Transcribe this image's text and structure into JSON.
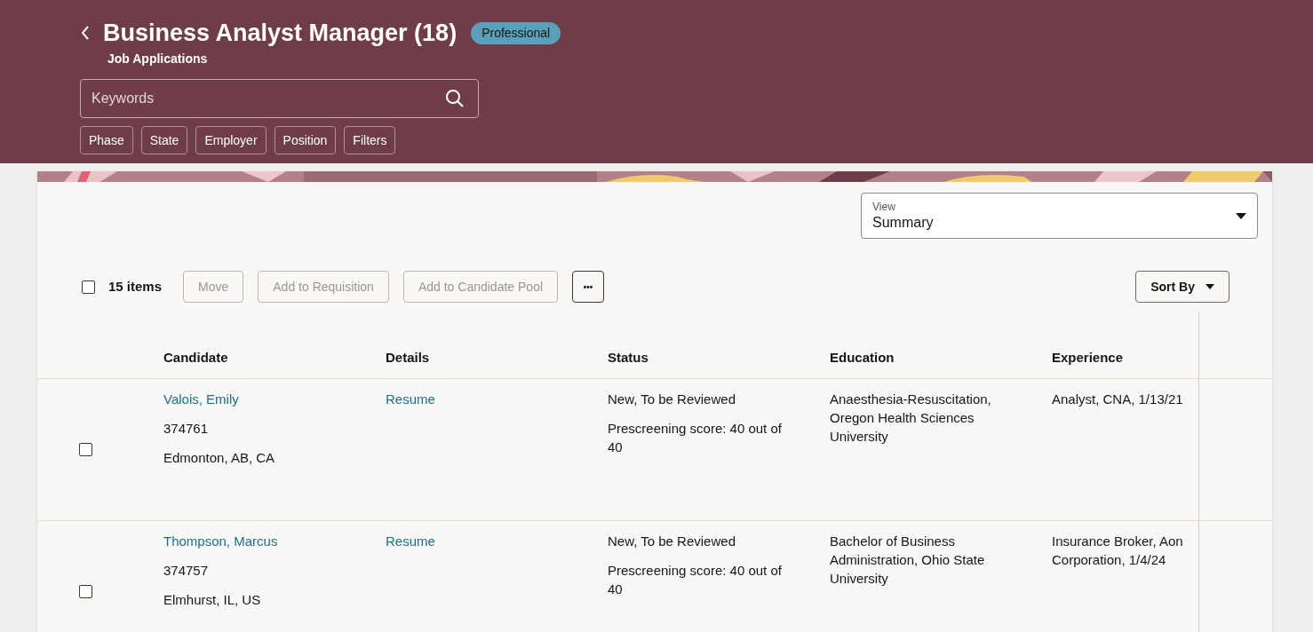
{
  "header": {
    "title": "Business Analyst Manager (18)",
    "badge": "Professional",
    "subtitle": "Job Applications"
  },
  "search": {
    "placeholder": "Keywords"
  },
  "filters": [
    "Phase",
    "State",
    "Employer",
    "Position",
    "Filters"
  ],
  "view": {
    "label": "View",
    "value": "Summary"
  },
  "toolbar": {
    "select_all_checked": false,
    "count": "15 items",
    "actions": [
      {
        "label": "Move",
        "disabled": true
      },
      {
        "label": "Add to Requisition",
        "disabled": true
      },
      {
        "label": "Add to Candidate Pool",
        "disabled": true
      }
    ],
    "more": "•••",
    "sort": "Sort By"
  },
  "table": {
    "columns": [
      "Candidate",
      "Details",
      "Status",
      "Education",
      "Experience"
    ],
    "rows": [
      {
        "checked": false,
        "name": "Valois, Emily",
        "id": "374761",
        "location": "Edmonton, AB, CA",
        "details": "Resume",
        "status": "New, To be Reviewed",
        "score": "Prescreening score: 40 out of 40",
        "education": "Anaesthesia-Resuscitation, Oregon Health Sciences University",
        "experience": "Analyst, CNA, 1/13/21"
      },
      {
        "checked": false,
        "name": "Thompson, Marcus",
        "id": "374757",
        "location": "Elmhurst, IL, US",
        "details": "Resume",
        "status": "New, To be Reviewed",
        "score": "Prescreening score: 40 out of 40",
        "education": "Bachelor of Business Administration, Ohio State University",
        "experience": "Insurance Broker, Aon Corporation, 1/4/24"
      }
    ]
  }
}
